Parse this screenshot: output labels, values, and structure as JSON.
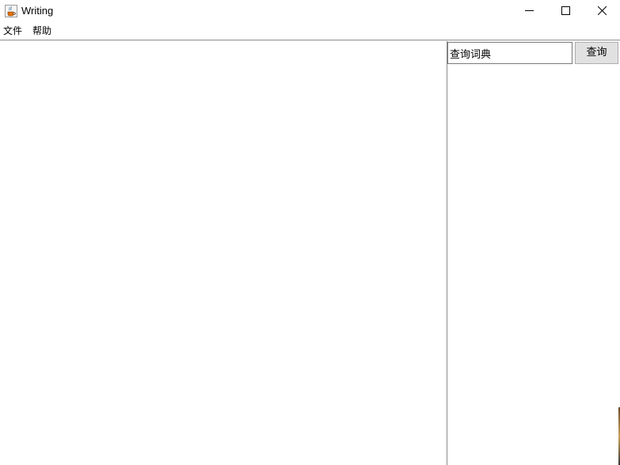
{
  "window": {
    "title": "Writing",
    "app_icon": "java-coffee-cup-icon",
    "controls": {
      "minimize_icon": "minimize-icon",
      "maximize_icon": "maximize-icon",
      "close_icon": "close-icon"
    }
  },
  "menubar": {
    "items": [
      {
        "label": "文件"
      },
      {
        "label": "帮助"
      }
    ]
  },
  "editor": {
    "content": ""
  },
  "dictionary": {
    "search_value": "查询词典",
    "query_button_label": "查询",
    "results_text": ""
  }
}
